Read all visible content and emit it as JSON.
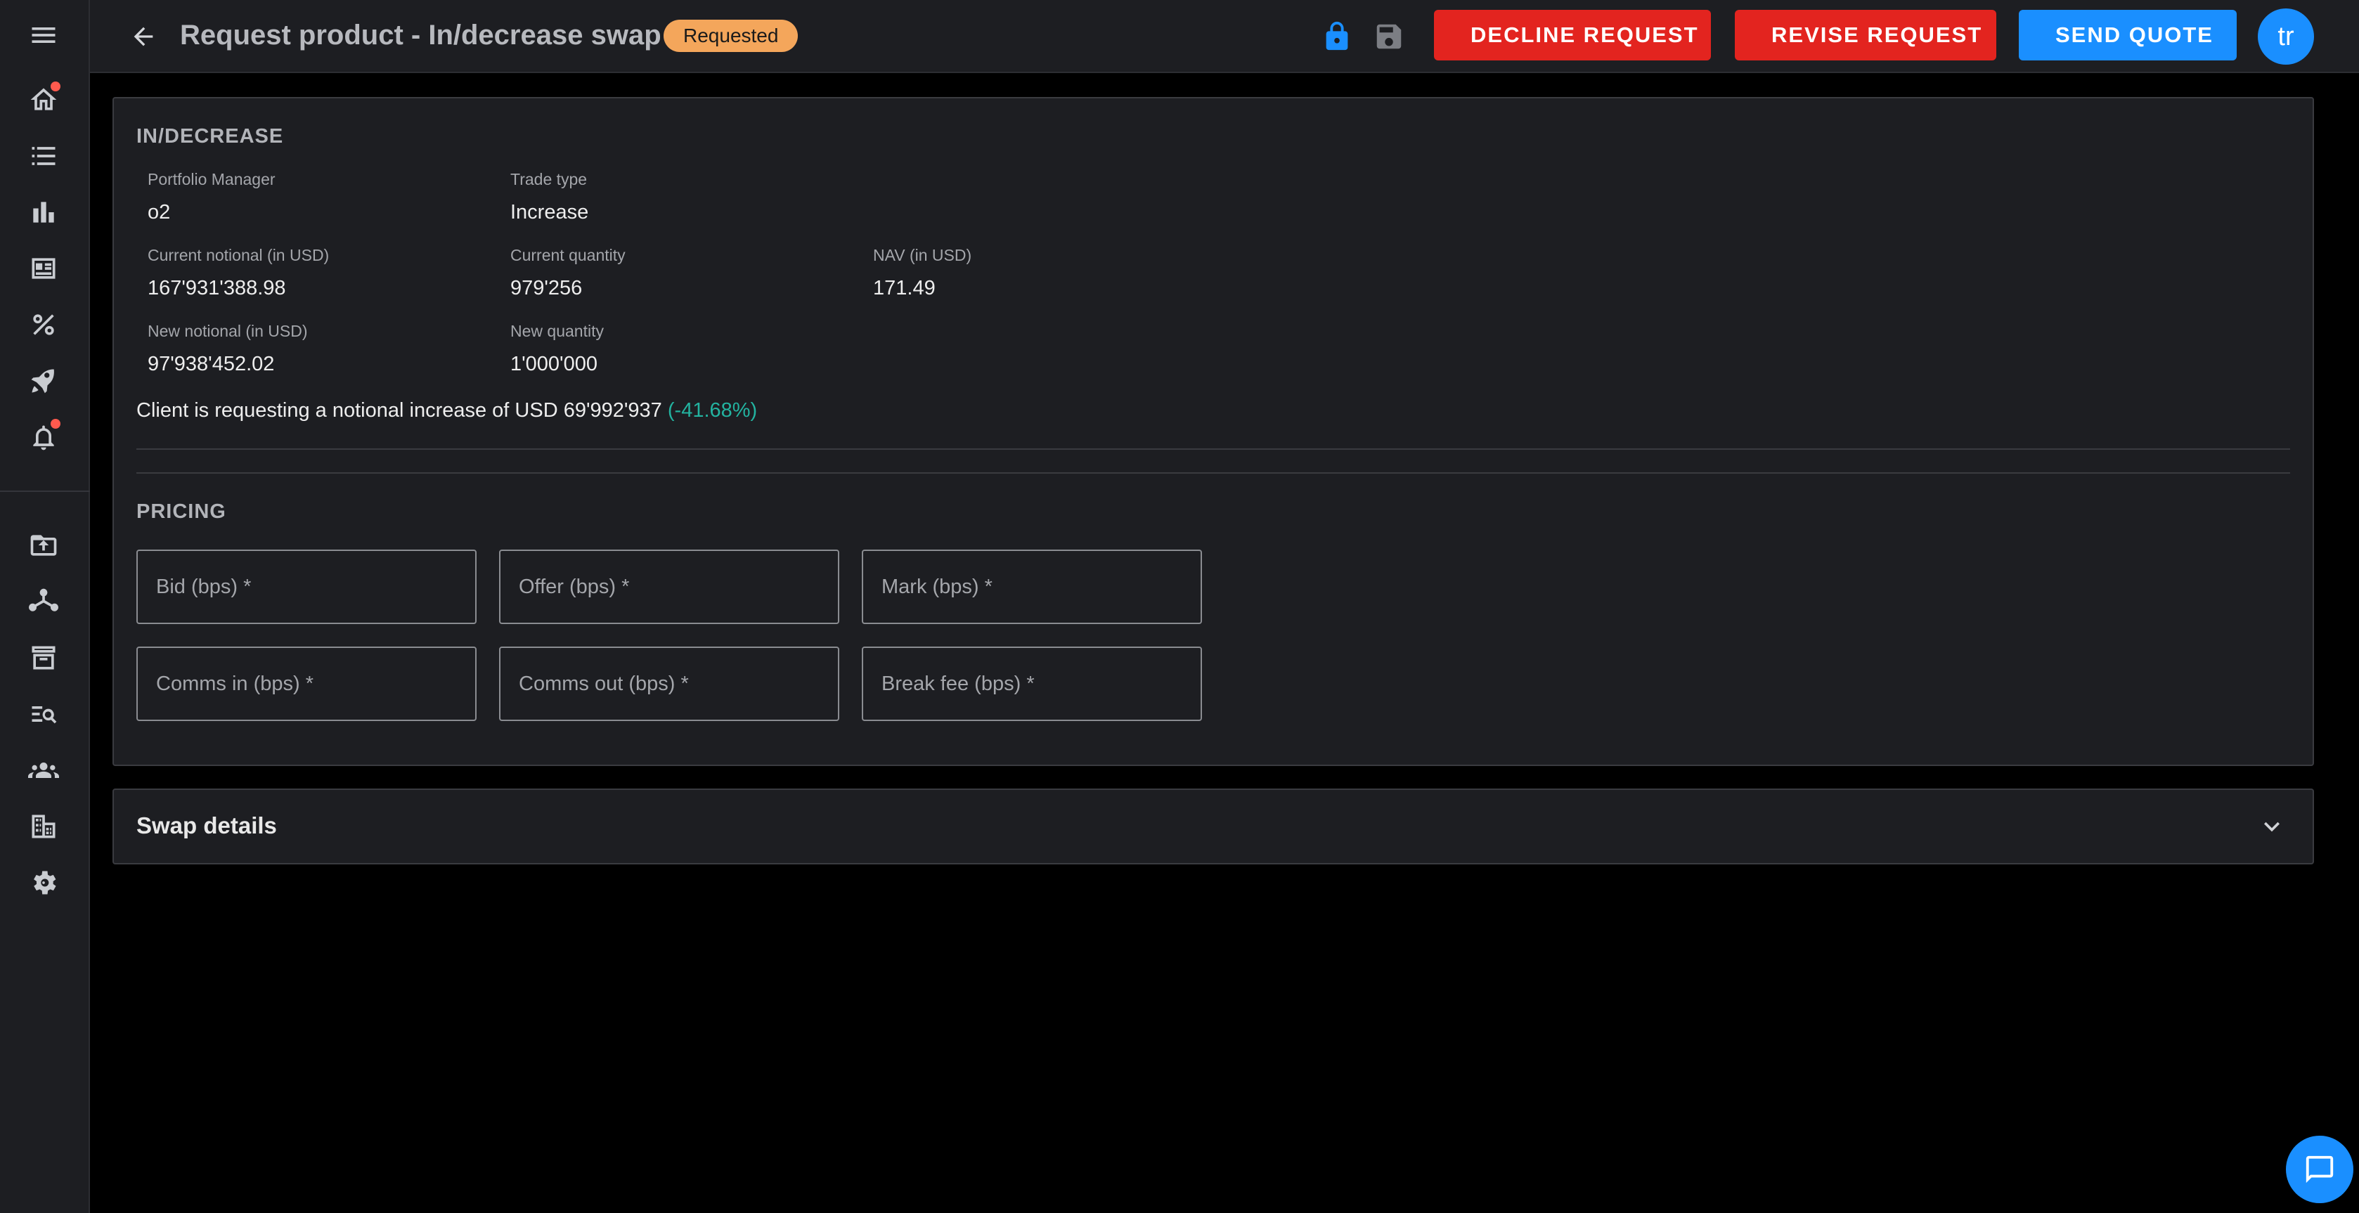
{
  "header": {
    "title": "Request product - In/decrease swap",
    "status": "Requested",
    "status_color": "#f4a65b",
    "buttons": {
      "decline": "DECLINE REQUEST",
      "revise": "REVISE REQUEST",
      "send": "SEND QUOTE"
    },
    "avatar_initials": "tr"
  },
  "sidebar": {
    "items": [
      {
        "icon": "home-icon",
        "badge": true
      },
      {
        "icon": "list-icon",
        "badge": false
      },
      {
        "icon": "bar-chart-icon",
        "badge": false
      },
      {
        "icon": "news-icon",
        "badge": false
      },
      {
        "icon": "percent-icon",
        "badge": false
      },
      {
        "icon": "rocket-icon",
        "badge": false
      },
      {
        "icon": "alarm-icon",
        "badge": true
      },
      {
        "icon": "upload-folder-icon",
        "badge": false
      },
      {
        "icon": "hub-icon",
        "badge": false
      },
      {
        "icon": "archive-icon",
        "badge": false
      },
      {
        "icon": "search-list-icon",
        "badge": false
      },
      {
        "icon": "groups-icon",
        "badge": false
      },
      {
        "icon": "building-icon",
        "badge": false
      },
      {
        "icon": "settings-icon",
        "badge": false
      }
    ]
  },
  "in_decrease": {
    "section_title": "IN/DECREASE",
    "portfolio_manager_label": "Portfolio Manager",
    "portfolio_manager_value": "o2",
    "trade_type_label": "Trade type",
    "trade_type_value": "Increase",
    "current_notional_label": "Current notional (in USD)",
    "current_notional_value": "167'931'388.98",
    "current_quantity_label": "Current quantity",
    "current_quantity_value": "979'256",
    "nav_label": "NAV (in USD)",
    "nav_value": "171.49",
    "new_notional_label": "New notional (in USD)",
    "new_notional_value": "97'938'452.02",
    "new_quantity_label": "New quantity",
    "new_quantity_value": "1'000'000",
    "info_text": "Client is requesting a notional increase of USD 69'992'937",
    "info_pct": "(-41.68%)"
  },
  "pricing": {
    "section_title": "PRICING",
    "bid_placeholder": "Bid (bps) *",
    "offer_placeholder": "Offer (bps) *",
    "mark_placeholder": "Mark (bps) *",
    "comms_in_placeholder": "Comms in (bps) *",
    "comms_out_placeholder": "Comms out (bps) *",
    "break_fee_placeholder": "Break fee (bps) *"
  },
  "swap_details": {
    "title": "Swap details"
  },
  "colors": {
    "accent": "#1a8fff",
    "danger": "#e3241f",
    "positive_pct": "#23b3a0"
  }
}
